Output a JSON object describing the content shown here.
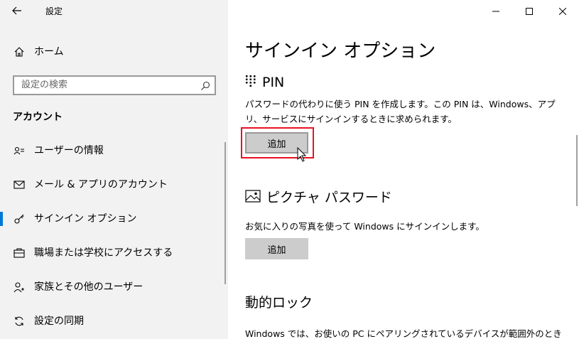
{
  "window": {
    "title": "設定",
    "controls": [
      "minimize-icon",
      "maximize-icon",
      "close-icon"
    ]
  },
  "sidebar": {
    "home_label": "ホーム",
    "search_placeholder": "設定の検索",
    "section_header": "アカウント",
    "items": [
      {
        "label": "ユーザーの情報",
        "icon": "user-info-icon",
        "selected": false
      },
      {
        "label": "メール & アプリのアカウント",
        "icon": "mail-icon",
        "selected": false
      },
      {
        "label": "サインイン オプション",
        "icon": "key-icon",
        "selected": true
      },
      {
        "label": "職場または学校にアクセスする",
        "icon": "briefcase-icon",
        "selected": false
      },
      {
        "label": "家族とその他のユーザー",
        "icon": "add-person-icon",
        "selected": false
      },
      {
        "label": "設定の同期",
        "icon": "sync-icon",
        "selected": false
      }
    ]
  },
  "main": {
    "heading": "サインイン オプション",
    "pin": {
      "title": "PIN",
      "description": "パスワードの代わりに使う PIN を作成します。この PIN は、Windows、アプリ、サービスにサインインするときに求められます。",
      "button": "追加"
    },
    "picture_password": {
      "title": "ピクチャ パスワード",
      "description": "お気に入りの写真を使って Windows にサインインします。",
      "button": "追加"
    },
    "dynamic_lock": {
      "title": "動的ロック",
      "description": "Windows では、お使いの PC にペアリングされているデバイスが範囲外のとき"
    }
  },
  "colors": {
    "accent": "#0078d7",
    "highlight": "#e81123",
    "sidebar_bg": "#f2f2f2",
    "button_bg": "#cccccc"
  }
}
